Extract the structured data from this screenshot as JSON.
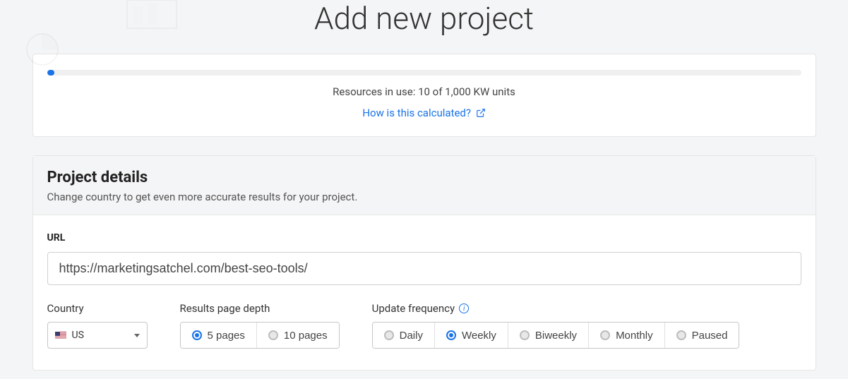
{
  "page": {
    "title": "Add new project"
  },
  "resources": {
    "usage_text": "Resources in use: 10 of 1,000 KW units",
    "calc_link": "How is this calculated?",
    "progress_percent": 1
  },
  "details": {
    "title": "Project details",
    "subtitle": "Change country to get even more accurate results for your project."
  },
  "url": {
    "label": "URL",
    "value": "https://marketingsatchel.com/best-seo-tools/"
  },
  "country": {
    "label": "Country",
    "selected": "US"
  },
  "depth": {
    "label": "Results page depth",
    "options": [
      "5 pages",
      "10 pages"
    ],
    "selected_index": 0
  },
  "frequency": {
    "label": "Update frequency",
    "options": [
      "Daily",
      "Weekly",
      "Biweekly",
      "Monthly",
      "Paused"
    ],
    "selected_index": 1
  }
}
